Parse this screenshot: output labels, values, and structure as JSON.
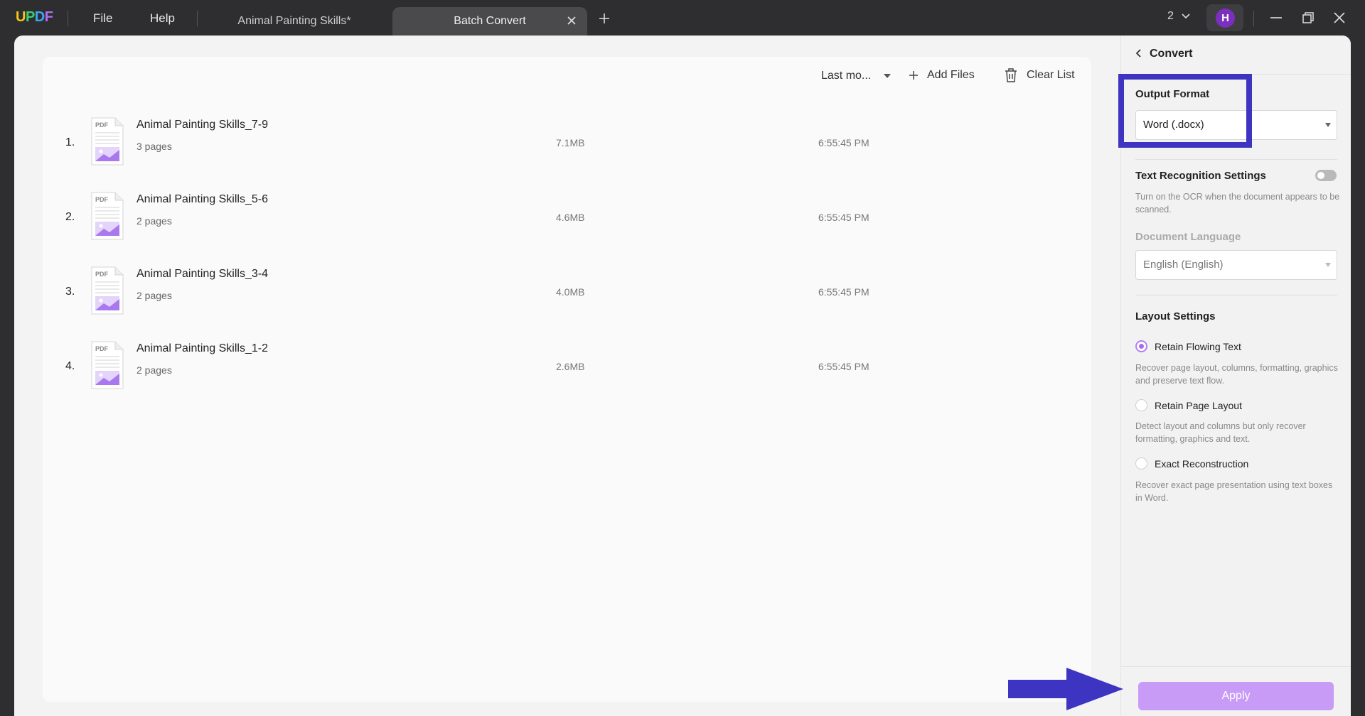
{
  "titlebar": {
    "logo": "UPDF",
    "menu": {
      "file": "File",
      "help": "Help"
    },
    "tabs": [
      {
        "label": "Animal Painting Skills*",
        "active": false
      },
      {
        "label": "Batch Convert",
        "active": true
      }
    ],
    "window_count": "2",
    "avatar_letter": "H"
  },
  "toolbar": {
    "sort_label": "Last mo...",
    "add_files": "Add Files",
    "clear_list": "Clear List"
  },
  "files": [
    {
      "index": "1.",
      "name": "Animal Painting Skills_7-9",
      "pages": "3 pages",
      "size": "7.1MB",
      "time": "6:55:45 PM"
    },
    {
      "index": "2.",
      "name": "Animal Painting Skills_5-6",
      "pages": "2 pages",
      "size": "4.6MB",
      "time": "6:55:45 PM"
    },
    {
      "index": "3.",
      "name": "Animal Painting Skills_3-4",
      "pages": "2 pages",
      "size": "4.0MB",
      "time": "6:55:45 PM"
    },
    {
      "index": "4.",
      "name": "Animal Painting Skills_1-2",
      "pages": "2 pages",
      "size": "2.6MB",
      "time": "6:55:45 PM"
    }
  ],
  "panel": {
    "title": "Convert",
    "output_format_label": "Output Format",
    "output_format_value": "Word (.docx)",
    "ocr_label": "Text Recognition Settings",
    "ocr_hint": "Turn on the OCR when the document appears to be scanned.",
    "ocr_enabled": false,
    "language_label": "Document Language",
    "language_value": "English (English)",
    "layout_label": "Layout Settings",
    "layout_options": [
      {
        "label": "Retain Flowing Text",
        "hint": "Recover page layout, columns, formatting, graphics and preserve text flow.",
        "checked": true
      },
      {
        "label": "Retain Page Layout",
        "hint": "Detect layout and columns but only recover formatting, graphics and text.",
        "checked": false
      },
      {
        "label": "Exact Reconstruction",
        "hint": "Recover exact page presentation using text boxes in Word.",
        "checked": false
      }
    ],
    "apply_label": "Apply"
  },
  "colors": {
    "accent": "#b47ef5",
    "apply_button": "#c89bf7",
    "annotation": "#3d35c2",
    "avatar": "#7b2fbe"
  }
}
